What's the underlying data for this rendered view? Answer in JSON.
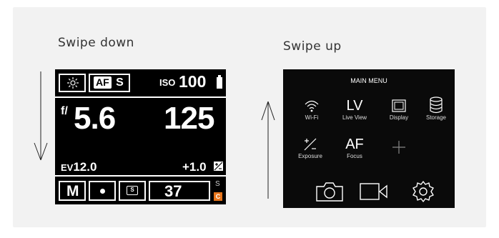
{
  "captions": {
    "left": "Swipe down",
    "right": "Swipe up"
  },
  "status_screen": {
    "mode_icon": "sun-icon",
    "af_label": "AF",
    "af_mode": "S",
    "iso_label": "ISO",
    "iso_value": "100",
    "aperture_prefix": "f/",
    "aperture_value": "5.6",
    "shutter_value": "125",
    "ev_label": "EV",
    "ev_value": "12.0",
    "exposure_comp": "+1.0",
    "exposure_mode": "M",
    "metering_icon": "spot-metering-icon",
    "drive_label": "S",
    "shots_remaining": "37",
    "card_slot": "S",
    "card_label": "C",
    "accent_color": "#e8751a"
  },
  "menu_screen": {
    "title": "MAIN MENU",
    "items": [
      {
        "icon": "wifi-icon",
        "label": "Wi-Fi"
      },
      {
        "icon": "LV",
        "label": "Live View"
      },
      {
        "icon": "display-icon",
        "label": "Display"
      },
      {
        "icon": "storage-icon",
        "label": "Storage"
      },
      {
        "icon": "exposure-icon",
        "label": "Exposure"
      },
      {
        "icon": "AF",
        "label": "Focus"
      },
      {
        "icon": "plus-icon",
        "label": ""
      }
    ],
    "bottom_icons": [
      "camera-icon",
      "video-icon",
      "settings-icon"
    ]
  }
}
